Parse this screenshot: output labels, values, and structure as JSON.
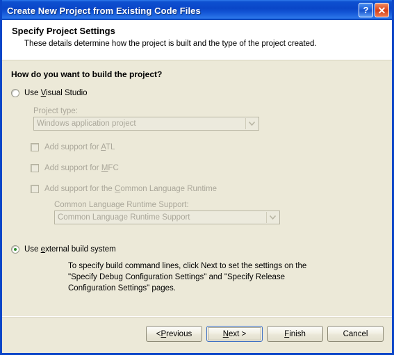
{
  "window": {
    "title": "Create New Project from Existing Code Files",
    "help_button": "?",
    "close_button": "✕"
  },
  "header": {
    "title": "Specify Project Settings",
    "subtitle": "These details determine how the project is built and the type of the project created."
  },
  "body": {
    "question": "How do you want to build the project?",
    "option_visual_studio": {
      "label_before": "Use ",
      "label_accel": "V",
      "label_after": "isual Studio",
      "selected": false
    },
    "project_type_label": "Project type:",
    "project_type_value": "Windows application project",
    "checkbox_atl": {
      "label_before": "Add support for ",
      "label_accel": "A",
      "label_after": "TL",
      "checked": false
    },
    "checkbox_mfc": {
      "label_before": "Add support for ",
      "label_accel": "M",
      "label_after": "FC",
      "checked": false
    },
    "checkbox_clr": {
      "label_before": "Add support for the ",
      "label_accel": "C",
      "label_after": "ommon Language Runtime",
      "checked": false
    },
    "clr_support_label": "Common Language Runtime Support:",
    "clr_support_value": "Common Language Runtime Support",
    "option_external_build": {
      "label_before": "Use ",
      "label_accel": "e",
      "label_after": "xternal build system",
      "selected": true
    },
    "external_description": "To specify build command lines, click Next to set the settings on the \"Specify Debug Configuration Settings\" and \"Specify Release Configuration Settings\" pages."
  },
  "footer": {
    "previous": {
      "before": "< ",
      "accel": "P",
      "after": "revious"
    },
    "next": {
      "before": "",
      "accel": "N",
      "after": "ext >"
    },
    "finish": {
      "before": "",
      "accel": "F",
      "after": "inish"
    },
    "cancel": {
      "before": "Cancel",
      "accel": "",
      "after": ""
    }
  },
  "colors": {
    "titlebar_blue": "#0a46c8",
    "body_beige": "#ece9d8",
    "radio_green": "#2e8b2e",
    "disabled_text": "#aaa79a",
    "default_button_border": "#3c6fc4"
  }
}
